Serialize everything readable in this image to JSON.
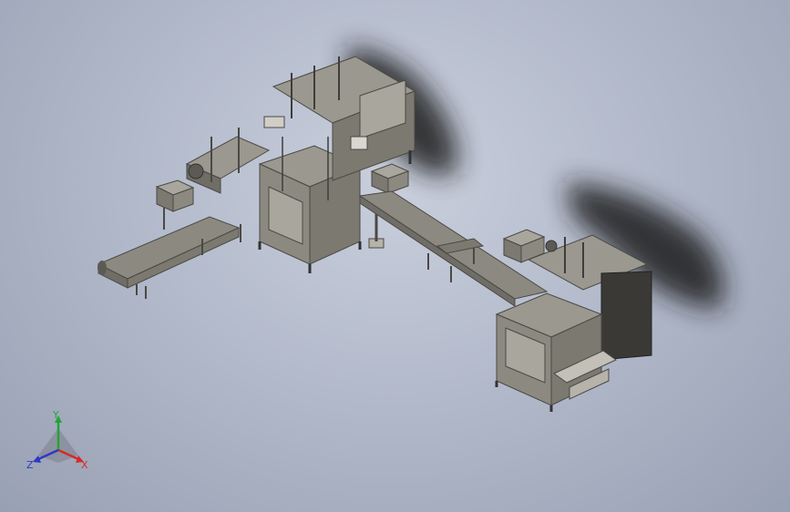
{
  "viewport": {
    "background_top": "#c9cfdc",
    "background_bottom": "#98a0b3",
    "model_color": "#8c8a80",
    "model_dark": "#4a4944",
    "shadow_color": "#1e1e1e"
  },
  "triad": {
    "x_label": "X",
    "y_label": "Y",
    "z_label": "Z",
    "x_color": "#d42a2a",
    "y_color": "#25a33a",
    "z_color": "#2c39c7"
  }
}
